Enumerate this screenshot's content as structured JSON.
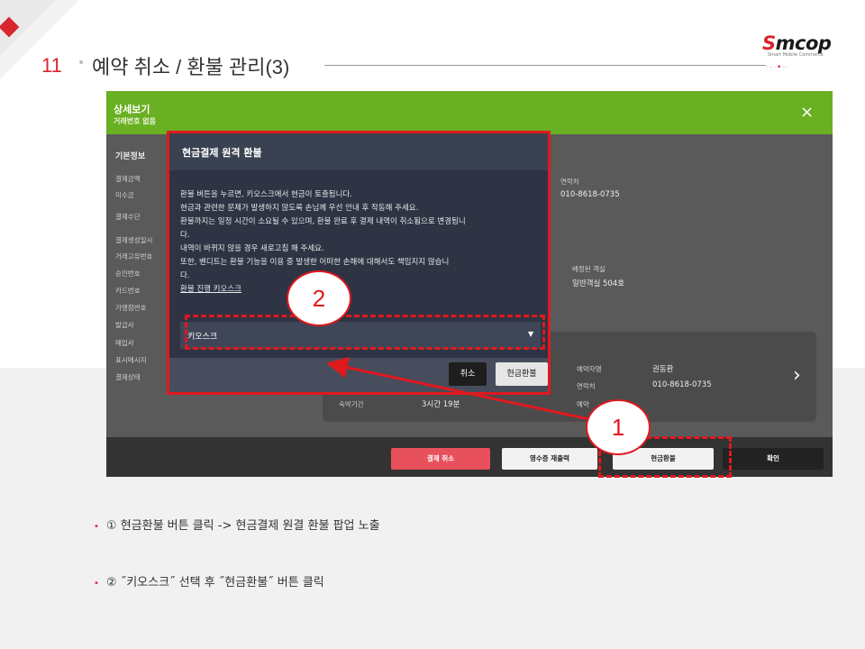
{
  "slide": {
    "number": "11",
    "title": "예약 취소 / 환불 관리(3)",
    "logo": {
      "brand_prefix": "S",
      "brand_rest": "mcop",
      "tagline": "Smart Mobile Commerce"
    }
  },
  "app": {
    "header": {
      "title": "상세보기",
      "subtitle": "거래번호 없음",
      "close_label": "×"
    },
    "sidebar": {
      "heading": "기본정보",
      "items": [
        "결제금액",
        "미수금",
        "결제수단",
        "결제생성일시",
        "거래고유번호",
        "승인번호",
        "카드번호",
        "가맹점번호",
        "발급사",
        "매입사",
        "표시메시지",
        "결제상태"
      ]
    },
    "info": {
      "contact_label": "연락처",
      "contact_value": "010-8618-0735",
      "room_label": "배정된 객실",
      "room_value": "일반객실 504호"
    },
    "card": {
      "stay_label": "숙박기간",
      "stay_value": "3시간 19분",
      "booker_label": "예약자명",
      "booker_value": "권동환",
      "phone_label": "연락처",
      "phone_value": "010-8618-0735",
      "extra_label": "예약"
    },
    "footer": {
      "cancel_payment": "결제 취소",
      "reprint_receipt": "영수증 재출력",
      "cash_refund": "현금환불",
      "confirm": "확인"
    },
    "colors": {
      "header_green": "#6ab023",
      "cancel_red": "#e8505b",
      "annotation_red": "#e0191f"
    }
  },
  "popup": {
    "title": "현금결제 원격 환불",
    "lines": [
      "환불 버튼을 누르면, 키오스크에서 현금이 토출됩니다.",
      "현금과 관련한 문제가 발생하지 않도록 손님께 우선 안내 후 작동해 주세요.",
      "환불까지는 일정 시간이 소요될 수 있으며, 환불 완료 후 결제 내역이 취소됨으로 변경됩니",
      "다.",
      "내역이 바뀌지 않을 경우 새로고침 해 주세요.",
      "또한, 벤디트는 환불 기능을 이용 중 발생한 어떠한 손해에 대해서도 책임지지 않습니",
      "다."
    ],
    "link": "환불 진행 키오스크",
    "select_value": "키오스크",
    "cancel_button": "취소",
    "refund_button": "현금환불"
  },
  "annotations": {
    "callout_1": "1",
    "callout_2": "2"
  },
  "bullets": [
    "① 현금환불 버튼 클릭 -> 현금결제 원결 환불 팝업 노출",
    "② ˝키오스크˝ 선택 후 ˝현금환불˝ 버튼 클릭"
  ]
}
